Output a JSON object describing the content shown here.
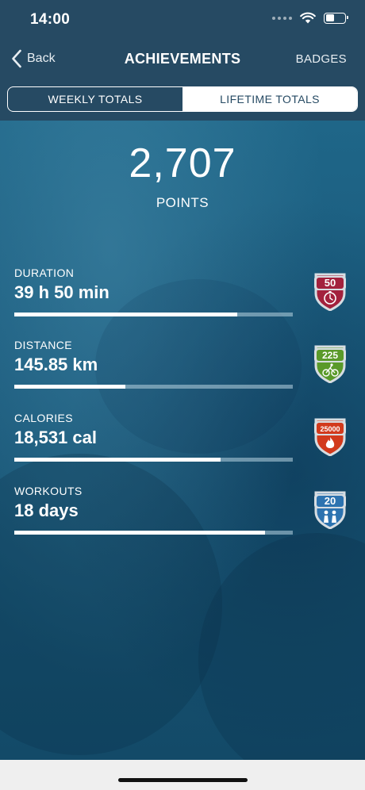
{
  "status_bar": {
    "time": "14:00"
  },
  "nav": {
    "back_label": "Back",
    "title": "ACHIEVEMENTS",
    "badges_label": "BADGES"
  },
  "tabs": [
    {
      "label": "WEEKLY TOTALS",
      "selected": false
    },
    {
      "label": "LIFETIME TOTALS",
      "selected": true
    }
  ],
  "summary": {
    "points_value": "2,707",
    "points_label": "POINTS"
  },
  "stats": [
    {
      "label": "DURATION",
      "value": "39 h 50 min",
      "progress": 0.8,
      "badge": {
        "text": "50",
        "icon": "stopwatch-icon",
        "color": "#a3213d"
      }
    },
    {
      "label": "DISTANCE",
      "value": "145.85 km",
      "progress": 0.4,
      "badge": {
        "text": "225",
        "icon": "cyclist-icon",
        "color": "#5a9a2a"
      }
    },
    {
      "label": "CALORIES",
      "value": "18,531 cal",
      "progress": 0.74,
      "badge": {
        "text": "25000",
        "icon": "flame-icon",
        "color": "#d23a1c"
      }
    },
    {
      "label": "WORKOUTS",
      "value": "18 days",
      "progress": 0.9,
      "badge": {
        "text": "20",
        "icon": "people-icon",
        "color": "#2d73b0"
      }
    }
  ],
  "colors": {
    "header_bg": "#264a63",
    "content_bg": "#1c5a7d",
    "track": "#aac8d7",
    "fill": "#ffffff"
  }
}
